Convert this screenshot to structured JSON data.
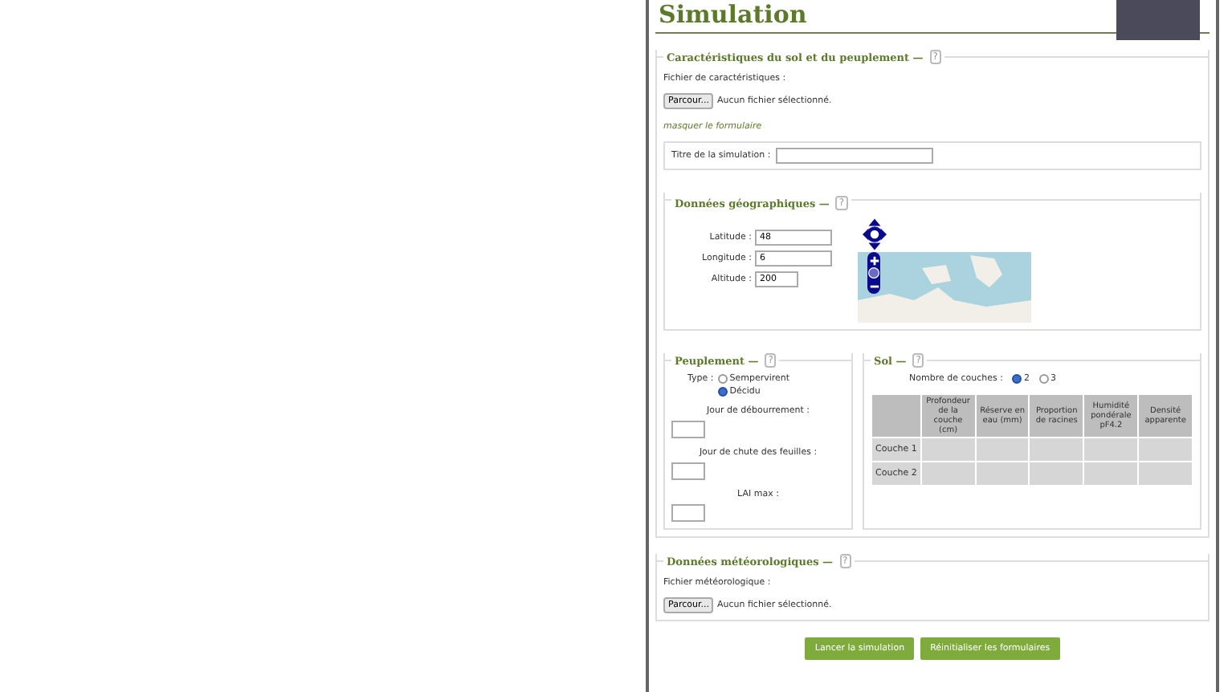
{
  "header": {
    "title": "Simulation"
  },
  "characteristics": {
    "legend": "Caractéristiques du sol et du peuplement —",
    "help": "?",
    "file_label": "Fichier de caractéristiques :",
    "browse_button": "Parcour...",
    "file_status": "Aucun fichier sélectionné.",
    "toggle_link": "masquer le formulaire",
    "title_label": "Titre de la simulation :"
  },
  "geography": {
    "legend": "Données géographiques —",
    "help": "?",
    "fields": [
      {
        "label": "Latitude :",
        "value": "48"
      },
      {
        "label": "Longitude :",
        "value": "6"
      },
      {
        "label": "Altitude :",
        "value": "200"
      }
    ]
  },
  "stand": {
    "legend": "Peuplement —",
    "help": "?",
    "type_label": "Type :",
    "types": [
      {
        "label": "Sempervirent",
        "selected": false
      },
      {
        "label": "Décidu",
        "selected": true
      }
    ],
    "fields": [
      "Jour de débourrement :",
      "Jour de chute des feuilles :",
      "LAI max :"
    ]
  },
  "soil": {
    "legend": "Sol —",
    "help": "?",
    "layers_label": "Nombre de couches :",
    "layer_options": [
      {
        "label": "2",
        "selected": true
      },
      {
        "label": "3",
        "selected": false
      }
    ],
    "columns": [
      "Profondeur de la couche (cm)",
      "Réserve en eau (mm)",
      "Proportion de racines",
      "Humidité pondérale pF4.2",
      "Densité apparente"
    ],
    "rows": [
      "Couche 1",
      "Couche 2"
    ]
  },
  "weather": {
    "legend": "Données météorologiques —",
    "help": "?",
    "file_label": "Fichier météorologique :",
    "browse_button": "Parcour...",
    "file_status": "Aucun fichier sélectionné."
  },
  "buttons": [
    "Lancer la simulation",
    "Réinitialiser les formulaires"
  ]
}
